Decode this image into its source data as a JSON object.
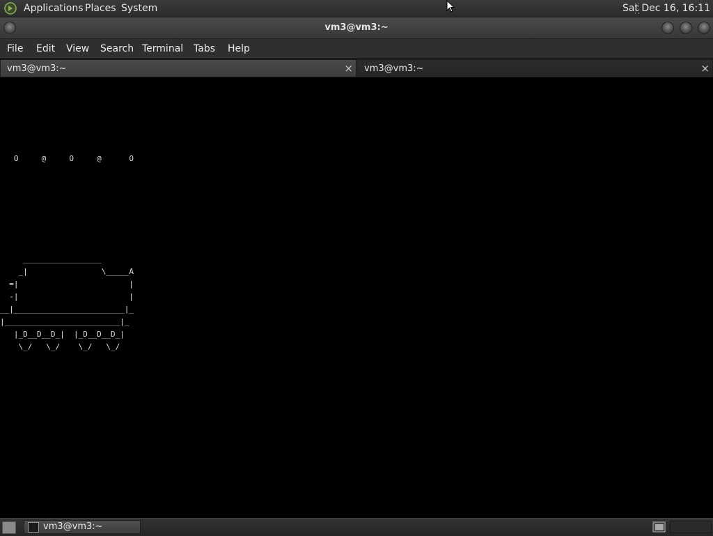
{
  "top_panel": {
    "menus": [
      "Applications",
      "Places",
      "System"
    ],
    "clock": "Sat Dec 16, 16:11"
  },
  "window": {
    "title": "vm3@vm3:~"
  },
  "menubar": [
    "File",
    "Edit",
    "View",
    "Search",
    "Terminal",
    "Tabs",
    "Help"
  ],
  "tabs": [
    {
      "label": "vm3@vm3:~",
      "close": "×"
    },
    {
      "label": "vm3@vm3:~",
      "close": "×"
    }
  ],
  "terminal": {
    "content": "\n\n\n\n\n\n   O     @     O     @      O\n\n\n\n\n\n\n\n     _________________\n    _|                \\_____A\n  =|                        |\n  -|                        |\n__|________________________|_\n|_________________________|_\n   |_D__D__D_|  |_D__D__D_|\n    \\_/   \\_/    \\_/   \\_/"
  },
  "bottom_panel": {
    "task_label": "vm3@vm3:~"
  },
  "colors": {
    "panel": "#2b2b2b",
    "terminal_bg": "#000000",
    "terminal_fg": "#e0e0e0"
  }
}
